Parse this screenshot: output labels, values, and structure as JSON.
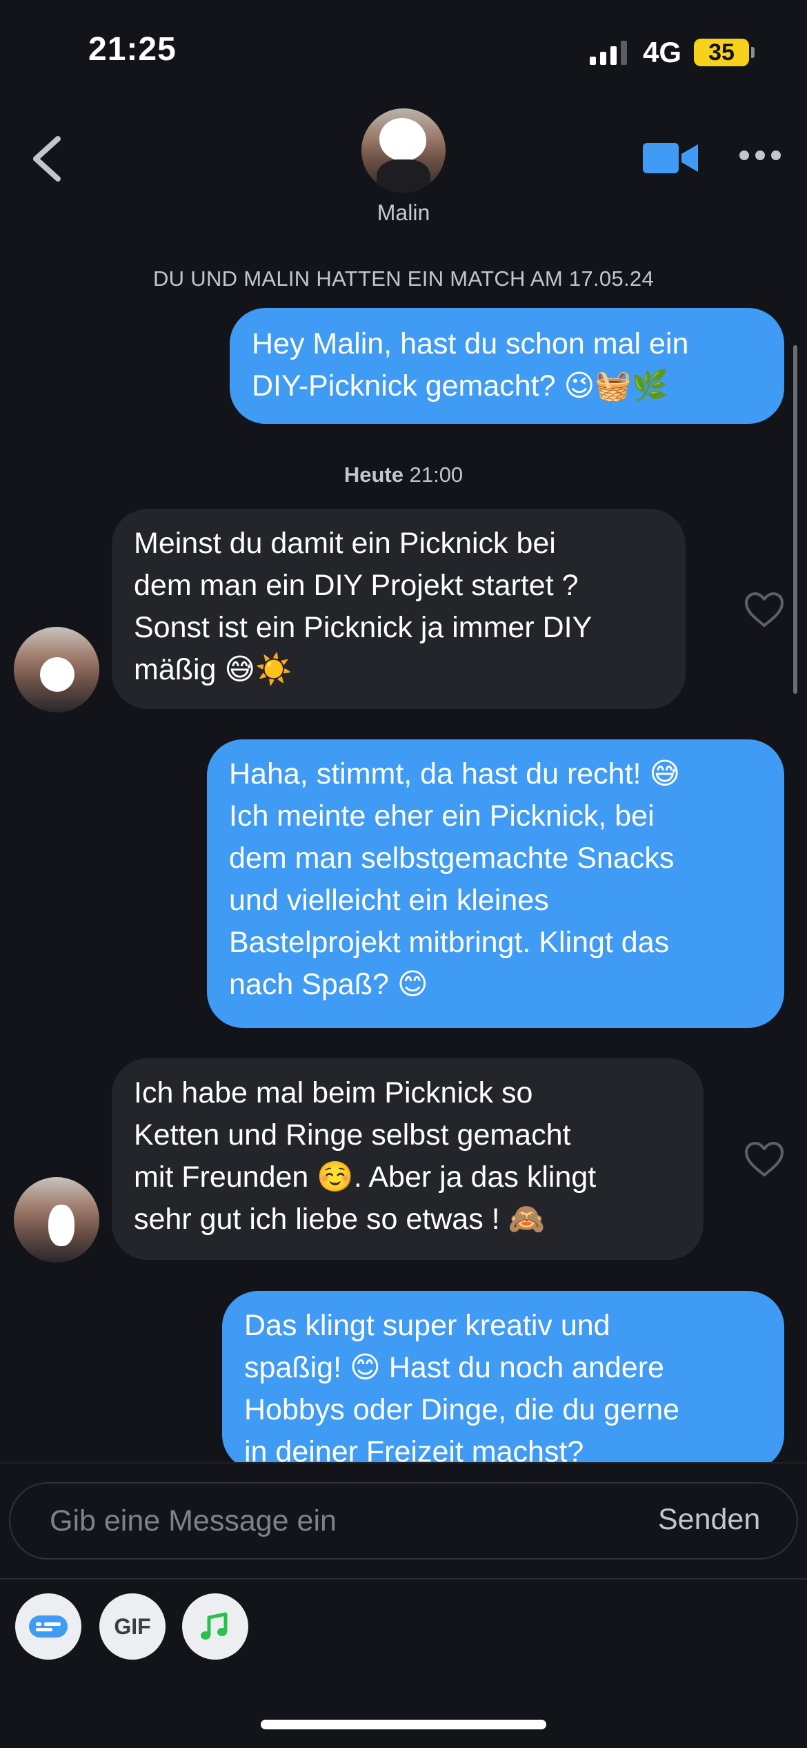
{
  "status_bar": {
    "time": "21:25",
    "network": "4G",
    "battery": "35"
  },
  "header": {
    "contact_name": "Malin"
  },
  "match_notice": "DU UND MALIN HATTEN EIN MATCH AM 17.05.24",
  "today_label": {
    "day": "Heute",
    "time": "21:00"
  },
  "messages": [
    {
      "dir": "out",
      "lines": [
        "Hey Malin, hast du schon mal ein",
        "DIY-Picknick gemacht? 😉🧺🌿"
      ]
    },
    {
      "dir": "in",
      "lines": [
        "Meinst du damit ein Picknick bei",
        "dem man ein DIY Projekt startet ?",
        "Sonst ist ein Picknick ja immer DIY",
        "mäßig 😅☀️"
      ]
    },
    {
      "dir": "out",
      "lines": [
        "Haha, stimmt, da hast du recht! 😅",
        "Ich meinte eher ein Picknick, bei",
        "dem man selbstgemachte Snacks",
        "und vielleicht ein kleines",
        "Bastelprojekt mitbringt. Klingt das",
        "nach Spaß? 😊"
      ]
    },
    {
      "dir": "in",
      "lines": [
        "Ich habe mal beim Picknick so",
        "Ketten und Ringe selbst gemacht",
        "mit Freunden ☺️. Aber ja das klingt",
        "sehr gut ich liebe so etwas ! 🙈"
      ]
    },
    {
      "dir": "out",
      "lines": [
        "Das klingt super kreativ und",
        "spaßig! 😊 Hast du noch andere",
        "Hobbys oder Dinge, die du gerne",
        "in deiner Freizeit machst?"
      ]
    }
  ],
  "composer": {
    "placeholder": "Gib eine Message ein",
    "send_label": "Senden"
  },
  "toolbar": {
    "gif_label": "GIF"
  },
  "colors": {
    "outgoing": "#3f9bf3",
    "incoming": "#23252b",
    "background": "#121419"
  }
}
